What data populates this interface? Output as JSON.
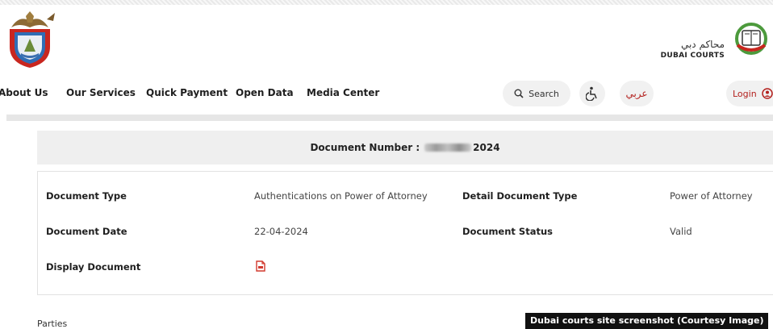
{
  "header": {
    "courts_name_ar": "محاكم دبي",
    "courts_name_en": "DUBAI COURTS",
    "accent_color": "#b3201d"
  },
  "nav": {
    "items": [
      "About Us",
      "Our Services",
      "Quick Payment",
      "Open Data",
      "Media Center"
    ],
    "search_label": "Search",
    "accessibility_icon": "accessibility-icon",
    "language_label": "عربي",
    "login_label": "Login"
  },
  "document": {
    "number_label": "Document Number :",
    "number_suffix": "2024",
    "type_label": "Document Type",
    "type_value": "Authentications on Power of Attorney",
    "detail_type_label": "Detail Document Type",
    "detail_type_value": "Power of Attorney",
    "date_label": "Document Date",
    "date_value": "22-04-2024",
    "status_label": "Document Status",
    "status_value": "Valid",
    "display_label": "Display Document",
    "display_icon": "pdf-file-icon"
  },
  "parties_label": "Parties",
  "caption": "Dubai courts site screenshot (Courtesy Image)"
}
